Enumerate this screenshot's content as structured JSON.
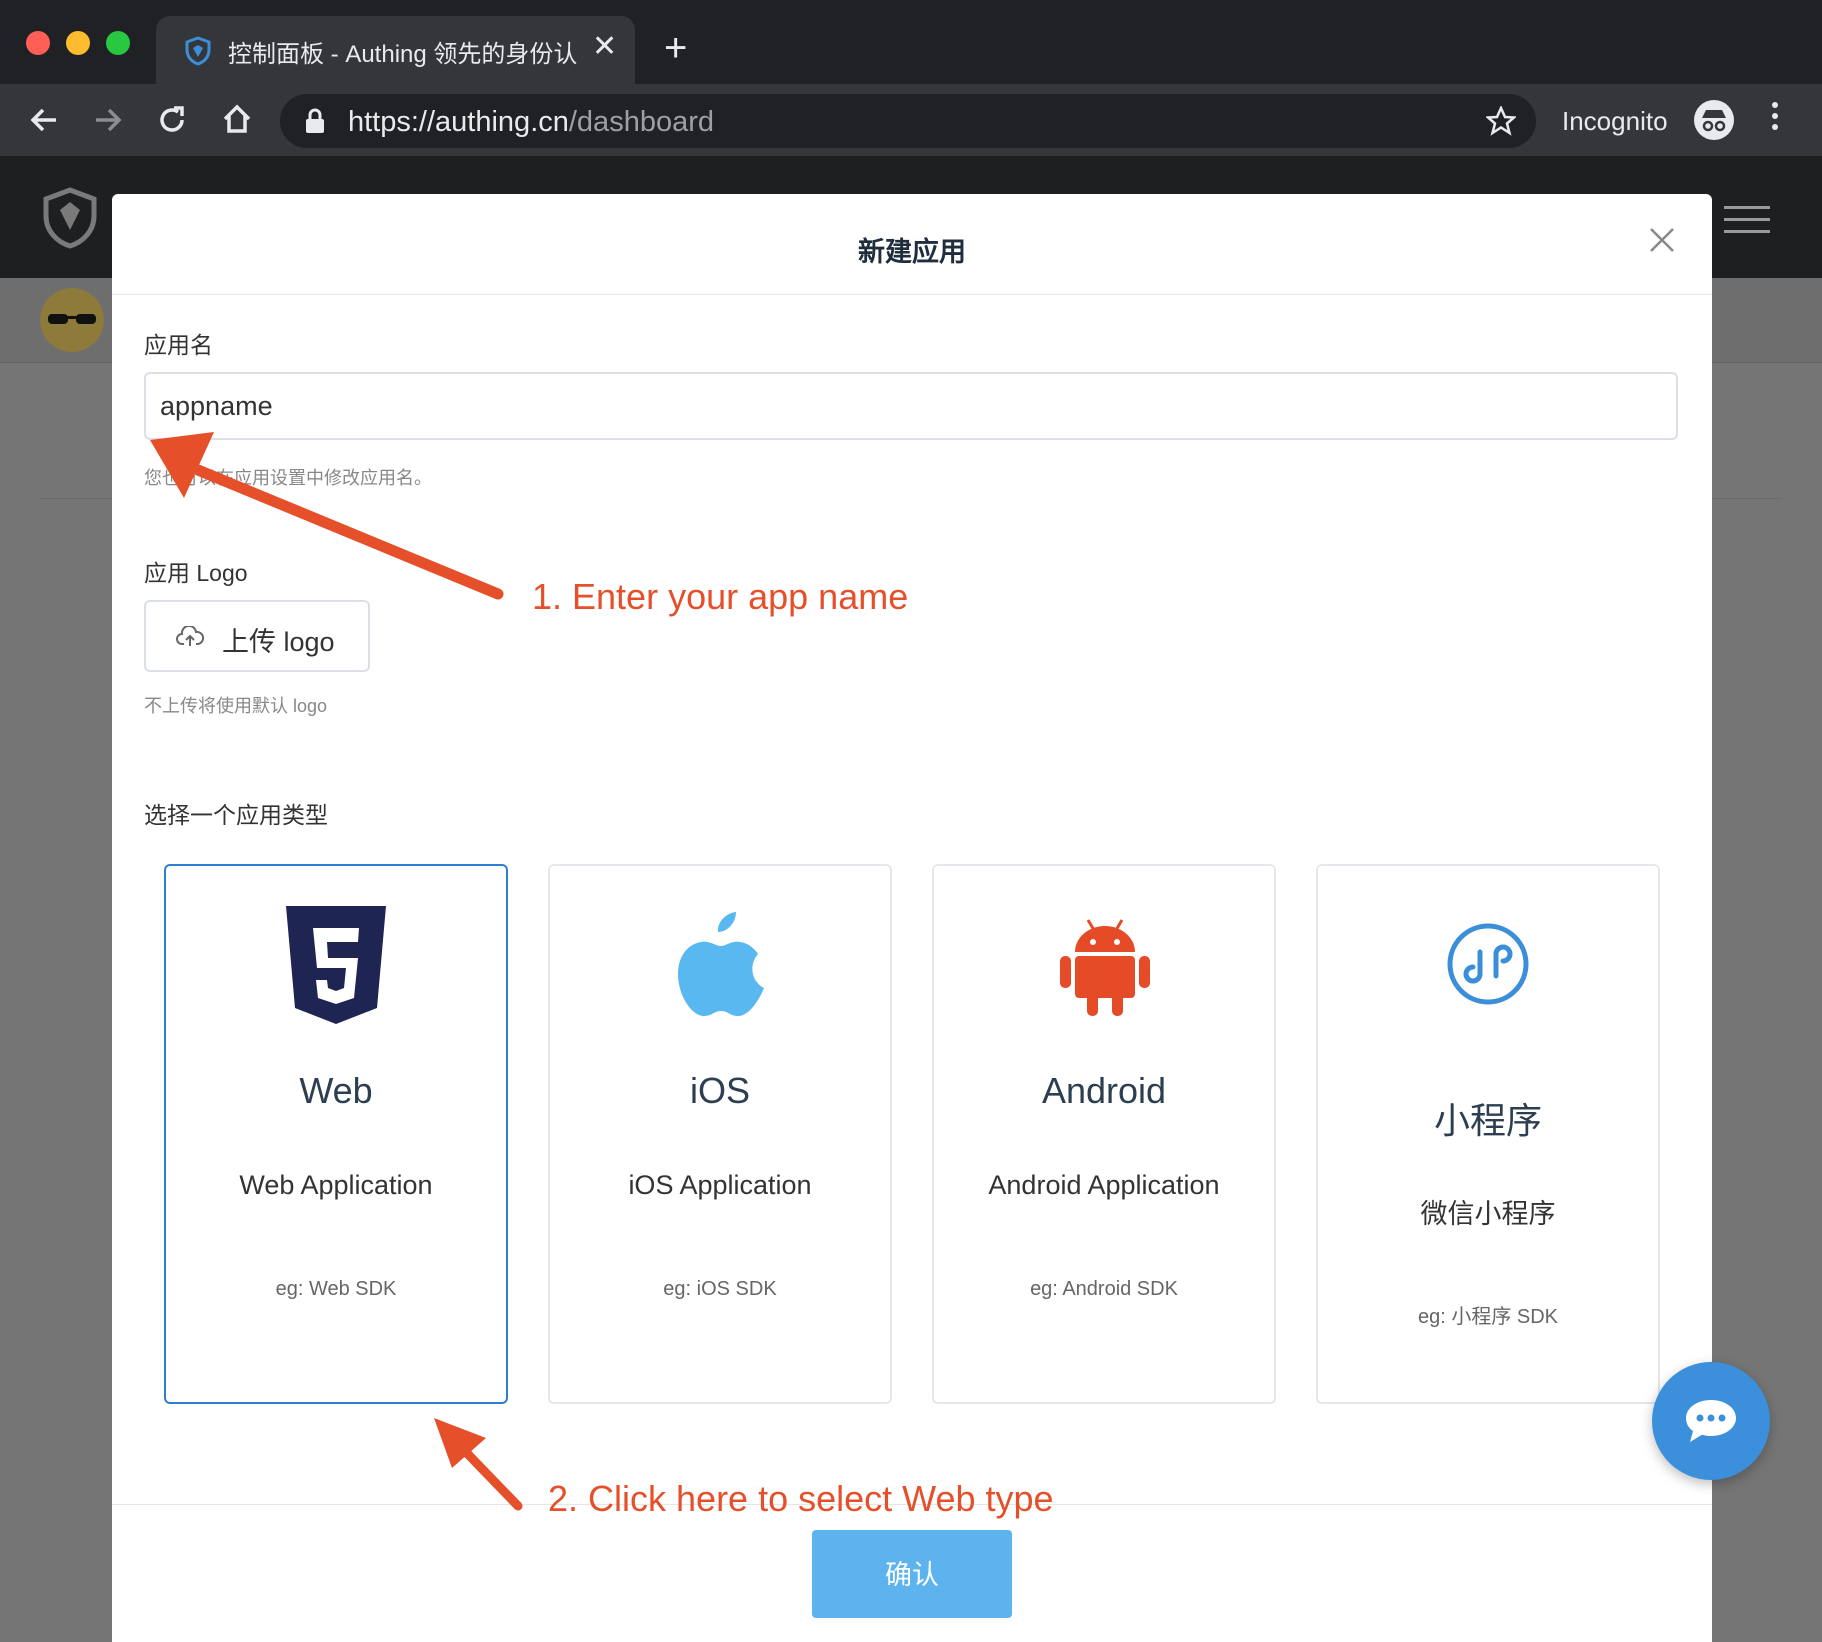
{
  "browser": {
    "tab_title": "控制面板 - Authing 领先的身份认证",
    "url_prefix": "https://",
    "url_host": "authing.cn",
    "url_path": "/dashboard",
    "incognito_label": "Incognito"
  },
  "modal": {
    "title": "新建应用",
    "app_name_label": "应用名",
    "app_name_value": "appname",
    "app_name_hint": "您也可以在应用设置中修改应用名。",
    "logo_label": "应用 Logo",
    "upload_label": "上传 logo",
    "logo_hint": "不上传将使用默认 logo",
    "type_label": "选择一个应用类型",
    "confirm_label": "确认",
    "app_types": [
      {
        "name": "Web",
        "desc": "Web Application",
        "eg": "eg: Web SDK",
        "icon": "html5-icon",
        "selected": true
      },
      {
        "name": "iOS",
        "desc": "iOS Application",
        "eg": "eg: iOS SDK",
        "icon": "apple-icon",
        "selected": false
      },
      {
        "name": "Android",
        "desc": "Android Application",
        "eg": "eg: Android SDK",
        "icon": "android-icon",
        "selected": false
      },
      {
        "name": "小程序",
        "desc": "微信小程序",
        "eg": "eg: 小程序 SDK",
        "icon": "mini-program-icon",
        "selected": false
      }
    ]
  },
  "annotations": {
    "step1": "1. Enter your app name",
    "step2": "2. Click here to select Web type"
  },
  "colors": {
    "accent": "#2d7fd6",
    "confirm": "#5cb3ee",
    "annotation": "#e5502b",
    "html5": "#1e2553",
    "apple": "#5ab8f0",
    "android": "#e44b26",
    "mini_program": "#3b8fd9"
  }
}
